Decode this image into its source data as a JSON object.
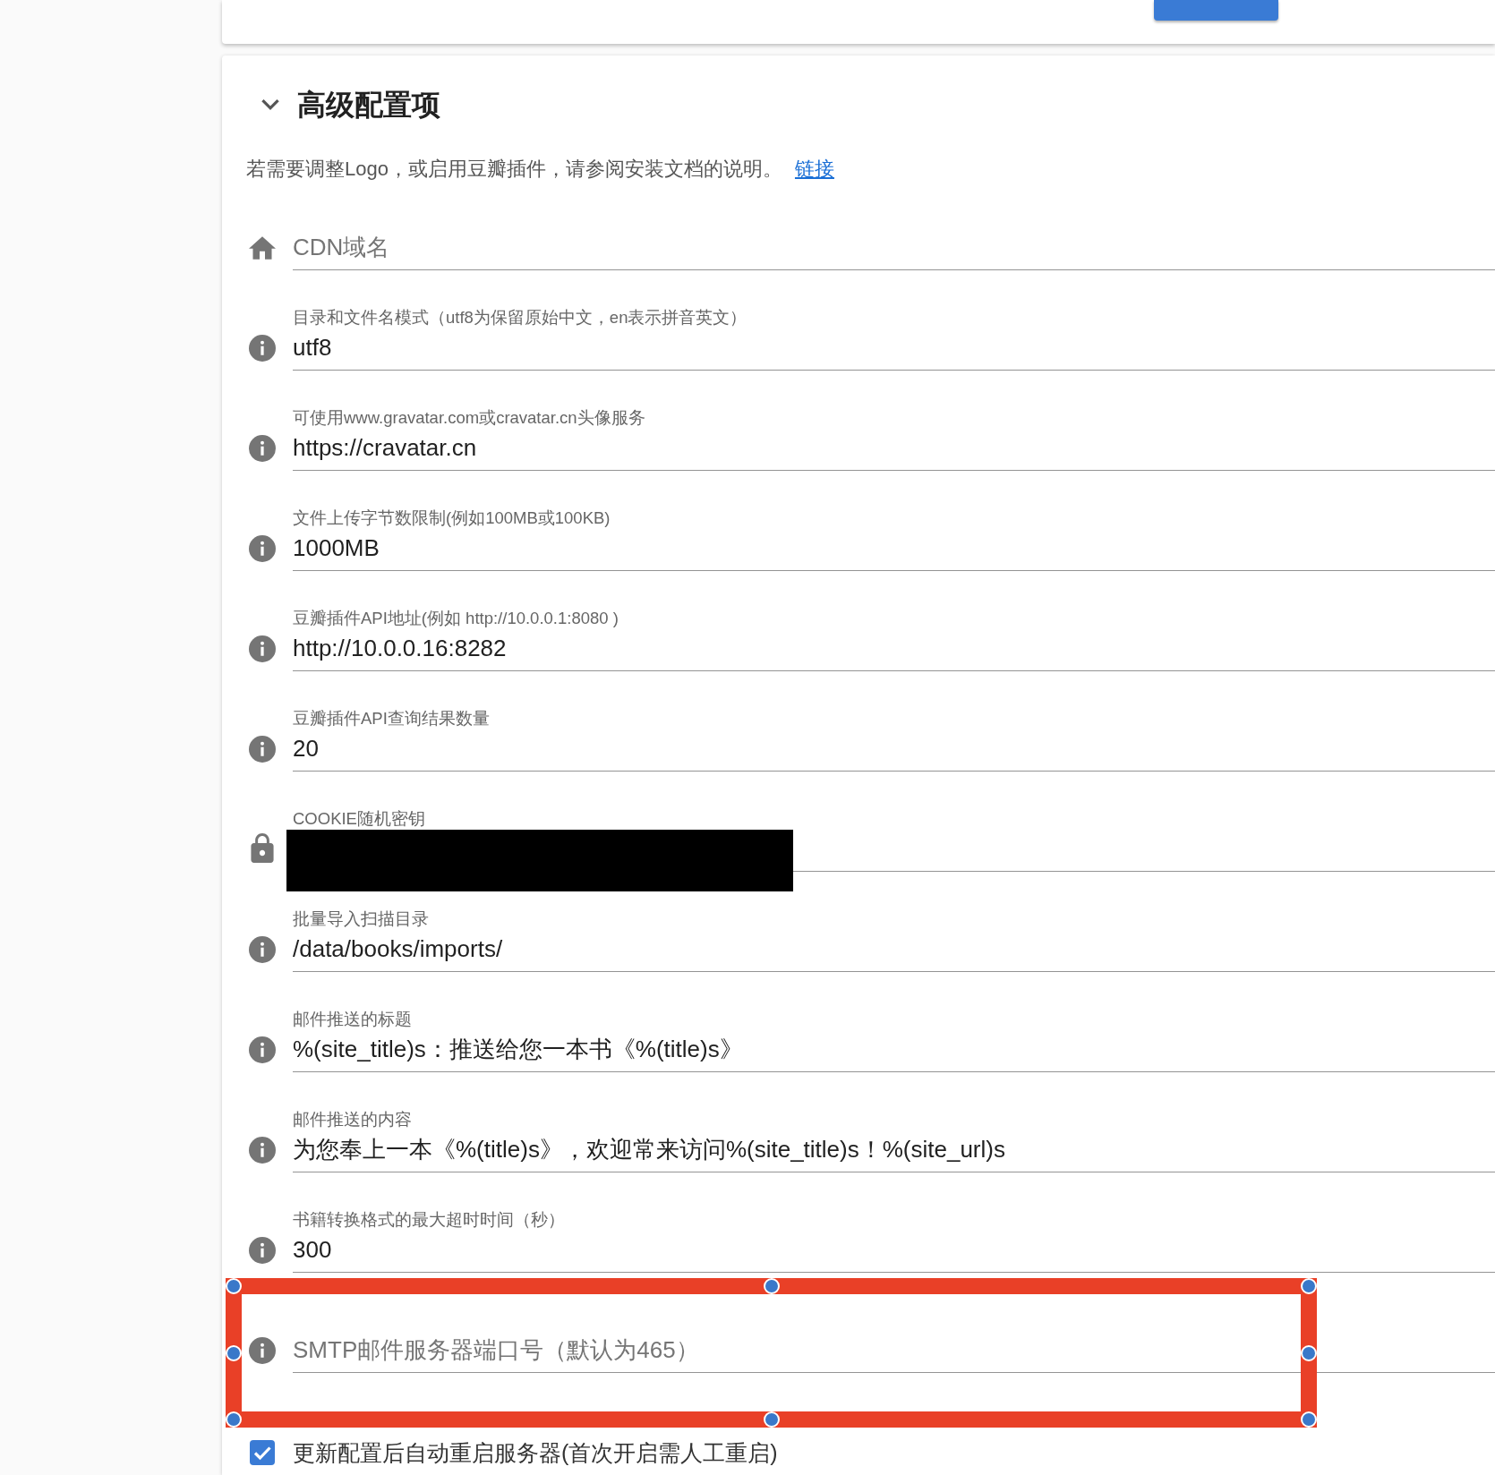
{
  "top_card": {
    "buttons": [
      {
        "kind": "primary"
      }
    ]
  },
  "section": {
    "title": "高级配置项",
    "expanded": true,
    "description": "若需要调整Logo，或启用豆瓣插件，请参阅安装文档的说明。",
    "link": "链接"
  },
  "fields": [
    {
      "kind": "site",
      "placeholder": "CDN域名"
    },
    {
      "kind": "setting",
      "label": "目录和文件名模式（utf8为保留原始中文，en表示拼音英文）",
      "value": "utf8"
    },
    {
      "kind": "setting",
      "label": "可使用www.gravatar.com或cravatar.cn头像服务",
      "value": "https://cravatar.cn"
    },
    {
      "kind": "setting",
      "label": "文件上传字节数限制(例如100MB或100KB)",
      "value": "1000MB"
    },
    {
      "kind": "setting",
      "label": "豆瓣插件API地址(例如 http://10.0.0.1:8080 )",
      "value": "http://10.0.0.16:8282"
    },
    {
      "kind": "setting",
      "label": "豆瓣插件API查询结果数量",
      "value": "20"
    },
    {
      "kind": "secret",
      "label": "COOKIE随机密钥",
      "redacted": true
    },
    {
      "kind": "setting",
      "label": "批量导入扫描目录",
      "value": "/data/books/imports/"
    },
    {
      "kind": "setting",
      "label": "邮件推送的标题",
      "value": "%(site_title)s：推送给您一本书《%(title)s》"
    },
    {
      "kind": "setting",
      "label": "邮件推送的内容",
      "value": "为您奉上一本《%(title)s》，欢迎常来访问%(site_title)s！%(site_url)s"
    },
    {
      "kind": "setting",
      "label": "书籍转换格式的最大超时时间（秒）",
      "value": "300"
    },
    {
      "kind": "setting",
      "placeholder": "SMTP邮件服务器端口号（默认为465）"
    }
  ],
  "restart_option": {
    "label": "更新配置后自动重启服务器(首次开启需人工重启)",
    "checked": true
  },
  "annotation": {
    "kind": "selection"
  }
}
